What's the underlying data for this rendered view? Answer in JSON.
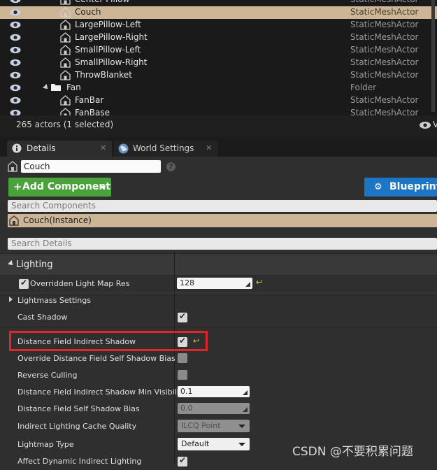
{
  "outliner": {
    "rows": [
      {
        "label": "Center Pillow",
        "type": "StaticMeshActor",
        "indent": 2,
        "icon": "actor-icon",
        "selected": false
      },
      {
        "label": "Couch",
        "type": "StaticMeshActor",
        "indent": 2,
        "icon": "actor-icon",
        "selected": true
      },
      {
        "label": "LargePillow-Left",
        "type": "StaticMeshActor",
        "indent": 2,
        "icon": "actor-icon",
        "selected": false
      },
      {
        "label": "LargePillow-Right",
        "type": "StaticMeshActor",
        "indent": 2,
        "icon": "actor-icon",
        "selected": false
      },
      {
        "label": "SmallPillow-Left",
        "type": "StaticMeshActor",
        "indent": 2,
        "icon": "actor-icon",
        "selected": false
      },
      {
        "label": "SmallPillow-Right",
        "type": "StaticMeshActor",
        "indent": 2,
        "icon": "actor-icon",
        "selected": false
      },
      {
        "label": "ThrowBlanket",
        "type": "StaticMeshActor",
        "indent": 2,
        "icon": "actor-icon",
        "selected": false
      },
      {
        "label": "Fan",
        "type": "Folder",
        "indent": 1,
        "icon": "folder-icon",
        "selected": false
      },
      {
        "label": "FanBar",
        "type": "StaticMeshActor",
        "indent": 2,
        "icon": "actor-icon",
        "selected": false
      },
      {
        "label": "FanBase",
        "type": "StaticMeshActor",
        "indent": 2,
        "icon": "actor-icon",
        "selected": false
      }
    ],
    "status": "265 actors (1 selected)",
    "view_options_label": "V"
  },
  "tabs": {
    "details": "Details",
    "world_settings": "World Settings"
  },
  "details": {
    "actor_name": "Couch",
    "add_component": "Add Component",
    "blueprint": "Blueprint/",
    "search_components_placeholder": "Search Components",
    "instance_label": "Couch(Instance)",
    "search_details_placeholder": "Search Details",
    "category": "Lighting"
  },
  "properties": {
    "overridden_lightmap_res": {
      "label": "Overridden Light Map Res",
      "value": "128"
    },
    "lightmass_settings": {
      "label": "Lightmass Settings"
    },
    "cast_shadow": {
      "label": "Cast Shadow",
      "checked": true
    },
    "distance_field_indirect_shadow": {
      "label": "Distance Field Indirect Shadow",
      "checked": true
    },
    "override_df_self_shadow_bias": {
      "label": "Override Distance Field Self Shadow Bias",
      "checked": false
    },
    "reverse_culling": {
      "label": "Reverse Culling",
      "checked": false
    },
    "df_indirect_shadow_min_visibility": {
      "label": "Distance Field Indirect Shadow Min Visibility",
      "value": "0.1"
    },
    "df_self_shadow_bias": {
      "label": "Distance Field Self Shadow Bias",
      "value": "0.0"
    },
    "indirect_lighting_cache_quality": {
      "label": "Indirect Lighting Cache Quality",
      "value": "ILCQ Point"
    },
    "lightmap_type": {
      "label": "Lightmap Type",
      "value": "Default"
    },
    "affect_dynamic_indirect_lighting": {
      "label": "Affect Dynamic Indirect Lighting"
    }
  },
  "watermark": "CSDN @不要积累问题",
  "colors": {
    "selected_row": "#cdb596",
    "highlight_box": "#e0262b",
    "add_green": "#4aa33a",
    "blueprint_blue": "#1d75c6"
  }
}
